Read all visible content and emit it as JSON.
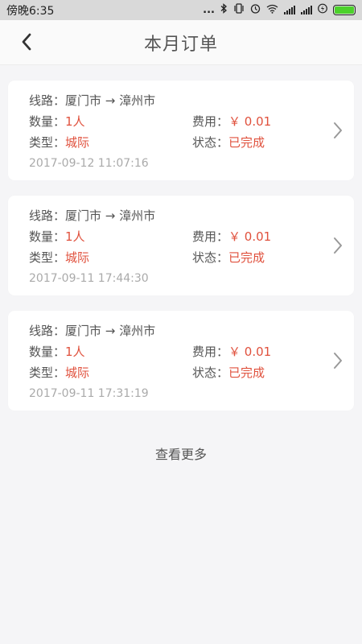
{
  "status_bar": {
    "time": "傍晚6:35",
    "dots": "...",
    "icons": [
      "bluetooth-icon",
      "vibrate-icon",
      "alarm-icon",
      "wifi-icon",
      "signal-icon",
      "signal-icon",
      "charging-icon",
      "battery-icon"
    ]
  },
  "header": {
    "title": "本月订单",
    "back_icon": "chevron-left-icon"
  },
  "labels": {
    "route": "线路：",
    "quantity": "数量：",
    "fee": "费用：",
    "type": "类型：",
    "status": "状态："
  },
  "orders": [
    {
      "route": "厦门市 → 漳州市",
      "quantity": "1人",
      "fee": "￥ 0.01",
      "type": "城际",
      "status": "已完成",
      "time": "2017-09-12 11:07:16"
    },
    {
      "route": "厦门市 → 漳州市",
      "quantity": "1人",
      "fee": "￥ 0.01",
      "type": "城际",
      "status": "已完成",
      "time": "2017-09-11 17:44:30"
    },
    {
      "route": "厦门市 → 漳州市",
      "quantity": "1人",
      "fee": "￥ 0.01",
      "type": "城际",
      "status": "已完成",
      "time": "2017-09-11 17:31:19"
    }
  ],
  "more_label": "查看更多",
  "colors": {
    "accent": "#e0513d",
    "background": "#f5f5f7",
    "battery": "#4cd12b"
  }
}
